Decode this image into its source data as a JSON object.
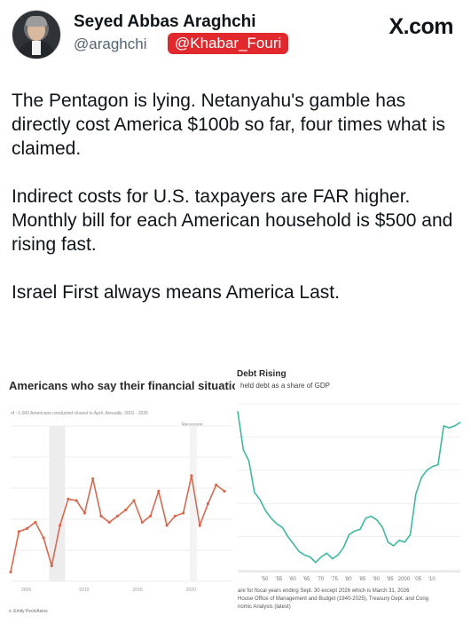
{
  "header": {
    "name": "Seyed Abbas Araghchi",
    "handle": "@araghchi",
    "source_badge": "@Khabar_Fouri",
    "site": "X.com"
  },
  "post": {
    "paragraphs": [
      "The Pentagon is lying. Netanyahu's gamble has directly cost America $100b so far, four times what is claimed.",
      "Indirect costs for U.S. taxpayers are FAR higher. Monthly bill for each American household is $500 and rising fast.",
      "Israel First always means America Last."
    ]
  },
  "colors": {
    "left_line": "#d9694f",
    "right_line": "#3fb8a0",
    "badge": "#e0282d"
  },
  "chart_data": [
    {
      "type": "line",
      "title": "Americans who say their financial situation is g",
      "subtitle": "of ~1,000 Americans conducted closest to April. Annually: 2001 - 2026",
      "annotation": "Recession",
      "x_ticks": [
        "2005",
        "2010",
        "2015",
        "2020"
      ],
      "x": [
        2001,
        2002,
        2003,
        2004,
        2005,
        2006,
        2007,
        2008,
        2009,
        2010,
        2011,
        2012,
        2013,
        2014,
        2015,
        2016,
        2017,
        2018,
        2019,
        2020,
        2021,
        2022,
        2023,
        2024,
        2025,
        2026
      ],
      "values": [
        6,
        32,
        34,
        38,
        28,
        10,
        36,
        53,
        52,
        44,
        66,
        42,
        38,
        42,
        46,
        52,
        38,
        42,
        58,
        36,
        42,
        44,
        68,
        36,
        50,
        62,
        58
      ],
      "ylim": [
        0,
        100
      ],
      "source_note": "s: Emily Peck/Axios"
    },
    {
      "type": "line",
      "title": "Debt Rising",
      "subtitle": "held debt as a share of GDP",
      "x_ticks": [
        "'50",
        "'55",
        "'60",
        "'65",
        "'70",
        "'75",
        "'80",
        "'85",
        "'90",
        "'95",
        "2000",
        "'05",
        "'10"
      ],
      "x": [
        1946,
        1948,
        1950,
        1952,
        1954,
        1956,
        1958,
        1960,
        1962,
        1964,
        1966,
        1968,
        1970,
        1972,
        1974,
        1976,
        1978,
        1980,
        1982,
        1984,
        1986,
        1988,
        1990,
        1992,
        1994,
        1996,
        1998,
        2000,
        2002,
        2004,
        2006,
        2008,
        2010,
        2012,
        2014,
        2016,
        2018,
        2020,
        2022,
        2024,
        2026
      ],
      "values": [
        106,
        85,
        79,
        62,
        58,
        52,
        48,
        45,
        43,
        38,
        34,
        30,
        28,
        27,
        24,
        27,
        29,
        26,
        28,
        32,
        39,
        41,
        42,
        48,
        49,
        47,
        43,
        35,
        33,
        36,
        35,
        39,
        61,
        70,
        74,
        76,
        77,
        98,
        97,
        98,
        100
      ],
      "notes": [
        "are for fiscal years ending Sept. 30 except 2026 which is March 31, 2026",
        "House Office of Management and Budget (1940-2025), Treasury Dept. and Cong",
        "nomic Analysis (latest)"
      ]
    }
  ]
}
